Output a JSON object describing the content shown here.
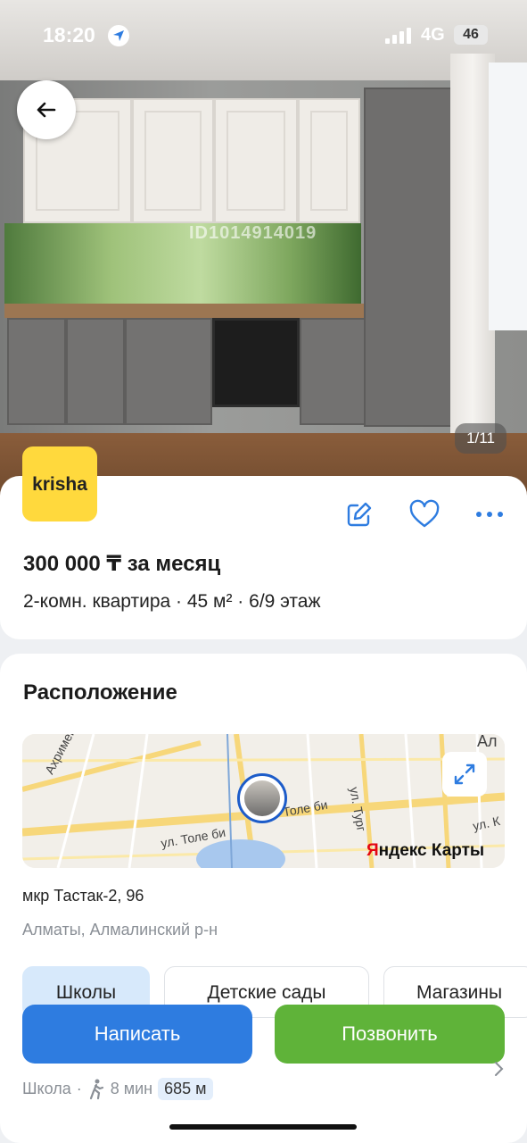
{
  "status_bar": {
    "time": "18:20",
    "network": "4G",
    "battery": "46"
  },
  "photo": {
    "watermark": "ID1014914019",
    "counter": "1/11"
  },
  "logo": {
    "text": "krisha",
    "color": "#ffd93d"
  },
  "listing": {
    "price": "300 000 ₸ за месяц",
    "details": "2-комн. квартира · 45 м² · 6/9 этаж"
  },
  "location": {
    "title": "Расположение",
    "map_labels": [
      "Ахрименко",
      "ул. Толе би",
      "Толе би",
      "ул. Тург",
      "ул. К",
      "Ал"
    ],
    "map_brand_red": "Я",
    "map_brand": "ндекс Карты",
    "address": "мкр Тастак-2, 96",
    "city": "Алматы, Алмалинский р-н"
  },
  "categories": [
    "Школы",
    "Детские сады",
    "Магазины"
  ],
  "nearby": {
    "type": "Школа",
    "time": "8 мин",
    "distance": "685 м"
  },
  "actions": {
    "write": "Написать",
    "call": "Позвонить"
  },
  "colors": {
    "primary": "#2e7ce0",
    "call": "#5fb339",
    "accent_icon": "#2e7ce0"
  },
  "icons": [
    "location-arrow-icon",
    "back-arrow-icon",
    "edit-icon",
    "heart-icon",
    "more-icon",
    "expand-icon",
    "walk-icon",
    "chevron-right-icon"
  ]
}
